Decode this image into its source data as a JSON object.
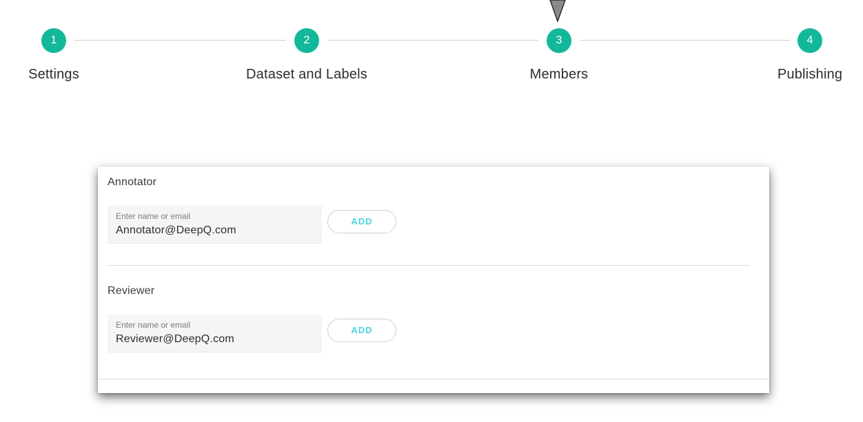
{
  "stepper": {
    "active_step": 3,
    "accent": "#13b89a",
    "steps": [
      {
        "number": "1",
        "label": "Settings"
      },
      {
        "number": "2",
        "label": "Dataset and Labels"
      },
      {
        "number": "3",
        "label": "Members"
      },
      {
        "number": "4",
        "label": "Publishing"
      }
    ]
  },
  "indicator_icon": "triangle-down-icon",
  "members": {
    "annotator": {
      "title": "Annotator",
      "input_placeholder": "Enter name or email",
      "input_value": "Annotator@DeepQ.com",
      "add_label": "ADD"
    },
    "reviewer": {
      "title": "Reviewer",
      "input_placeholder": "Enter name or email",
      "input_value": "Reviewer@DeepQ.com",
      "add_label": "ADD"
    }
  }
}
